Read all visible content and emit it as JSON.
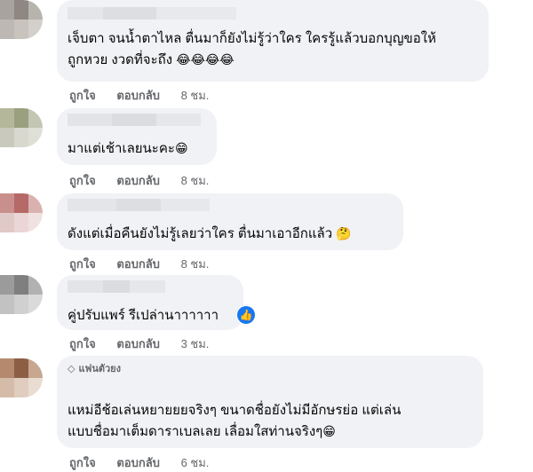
{
  "comments": [
    {
      "text_lines": [
        "เจ็บตา จนน้ำตาไหล ตื่นมาก็ยังไม่รู้ว่าใคร ใครรู้แล้วบอกบุญขอให้",
        "ถูกหวย งวดที่จะถึง"
      ],
      "emoji": "😂😂😂😂",
      "actions": {
        "like": "ถูกใจ",
        "reply": "ตอบกลับ",
        "time": "8 ชม."
      }
    },
    {
      "text_lines": [
        "มาแต่เช้าเลยนะคะ"
      ],
      "emoji": "😁",
      "actions": {
        "like": "ถูกใจ",
        "reply": "ตอบกลับ",
        "time": "8 ชม."
      }
    },
    {
      "text_lines": [
        "ดังแต่เมื่อคืนยังไม่รู้เลยว่าใคร ตื่นมาเอาอีกแล้ว"
      ],
      "emoji": "🤔",
      "actions": {
        "like": "ถูกใจ",
        "reply": "ตอบกลับ",
        "time": "8 ชม."
      }
    },
    {
      "text_lines": [
        "คู่ปรับแพร์ รีเปล่านาาาาาา"
      ],
      "emoji": "",
      "reaction": "like-reaction",
      "actions": {
        "like": "ถูกใจ",
        "reply": "ตอบกลับ",
        "time": "3 ชม."
      }
    },
    {
      "badge": "แฟนตัวยง",
      "text_lines": [
        "แหม่อีช้อเล่นหยายยยจริงๆ ขนาดชื่อยังไม่มีอักษรย่อ แต่เล่น",
        "แบบชื่อมาเต็มดาราเบลเลย เลื่อมใสท่านจริงๆ"
      ],
      "emoji": "😁",
      "actions": {
        "like": "ถูกใจ",
        "reply": "ตอบกลับ",
        "time": "6 ชม."
      }
    }
  ],
  "colors": {
    "bubble": "#f0f2f5",
    "text": "#050505",
    "meta": "#65676b",
    "like_blue": "#1877f2"
  }
}
